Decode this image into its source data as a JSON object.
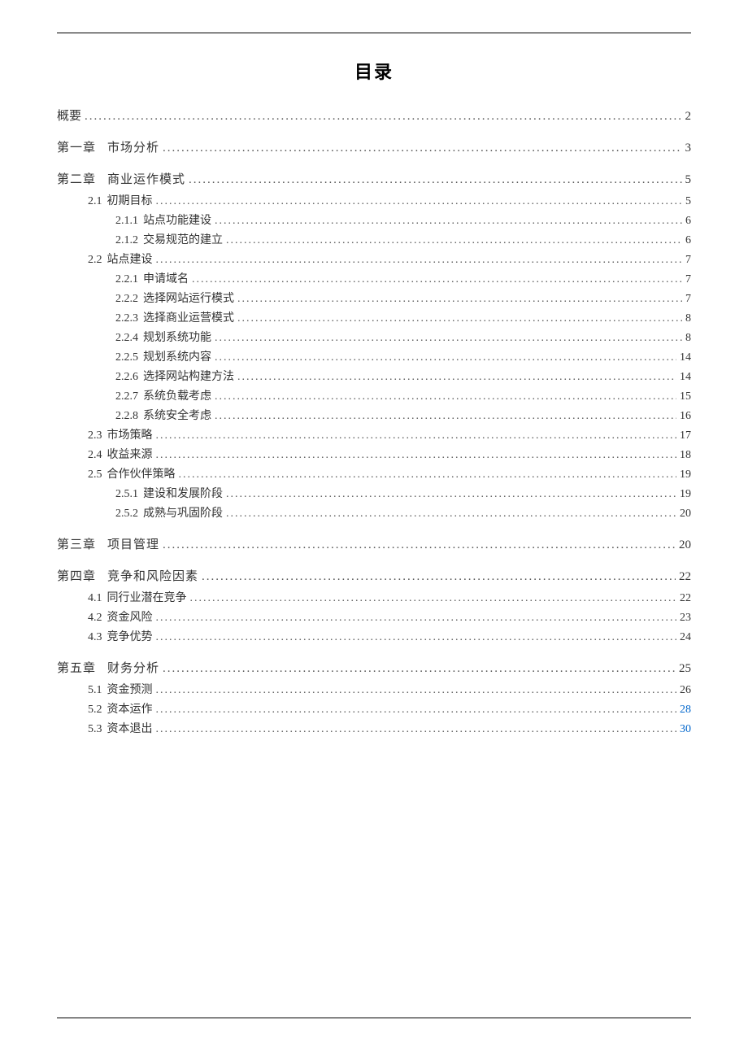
{
  "title": "目录",
  "entries": [
    {
      "level": "top",
      "label": "概要",
      "page": "2"
    },
    {
      "level": "chap",
      "chapter": "第一章",
      "title": "市场分析",
      "page": "3"
    },
    {
      "level": "chap",
      "chapter": "第二章",
      "title": "商业运作模式",
      "page": "5"
    },
    {
      "level": "sec",
      "no": "2.1",
      "title": "初期目标",
      "page": "5"
    },
    {
      "level": "sub",
      "no": "2.1.1",
      "title": "站点功能建设",
      "page": "6"
    },
    {
      "level": "sub",
      "no": "2.1.2",
      "title": "交易规范的建立",
      "page": "6"
    },
    {
      "level": "sec",
      "no": "2.2",
      "title": "站点建设",
      "page": "7"
    },
    {
      "level": "sub",
      "no": "2.2.1",
      "title": "申请域名",
      "page": "7"
    },
    {
      "level": "sub",
      "no": "2.2.2",
      "title": "选择网站运行模式",
      "page": "7"
    },
    {
      "level": "sub",
      "no": "2.2.3",
      "title": "选择商业运营模式",
      "page": "8"
    },
    {
      "level": "sub",
      "no": "2.2.4",
      "title": "规划系统功能",
      "page": "8"
    },
    {
      "level": "sub",
      "no": "2.2.5",
      "title": "规划系统内容",
      "page": "14"
    },
    {
      "level": "sub",
      "no": "2.2.6",
      "title": "选择网站构建方法",
      "page": "14"
    },
    {
      "level": "sub",
      "no": "2.2.7",
      "title": "系统负载考虑",
      "page": "15"
    },
    {
      "level": "sub",
      "no": "2.2.8",
      "title": "系统安全考虑",
      "page": "16"
    },
    {
      "level": "sec",
      "no": "2.3",
      "title": "市场策略",
      "page": "17"
    },
    {
      "level": "sec",
      "no": "2.4",
      "title": "收益来源",
      "page": "18"
    },
    {
      "level": "sec",
      "no": "2.5",
      "title": "合作伙伴策略",
      "page": "19"
    },
    {
      "level": "sub",
      "no": "2.5.1",
      "title": "建设和发展阶段",
      "page": "19"
    },
    {
      "level": "sub",
      "no": "2.5.2",
      "title": "成熟与巩固阶段",
      "page": "20"
    },
    {
      "level": "chap",
      "chapter": "第三章",
      "title": "项目管理",
      "page": "20"
    },
    {
      "level": "chap",
      "chapter": "第四章",
      "title": "竞争和风险因素",
      "page": "22"
    },
    {
      "level": "sec",
      "no": "4.1",
      "title": "同行业潜在竞争",
      "page": "22"
    },
    {
      "level": "sec",
      "no": "4.2",
      "title": "资金风险",
      "page": "23"
    },
    {
      "level": "sec",
      "no": "4.3",
      "title": "竞争优势",
      "page": "24"
    },
    {
      "level": "chap",
      "chapter": "第五章",
      "title": "财务分析",
      "page": "25"
    },
    {
      "level": "sec",
      "no": "5.1",
      "title": "资金预测",
      "page": "26"
    },
    {
      "level": "sec",
      "no": "5.2",
      "title": "资本运作",
      "page": "28",
      "link": true
    },
    {
      "level": "sec",
      "no": "5.3",
      "title": "资本退出",
      "page": "30",
      "link": true
    }
  ]
}
